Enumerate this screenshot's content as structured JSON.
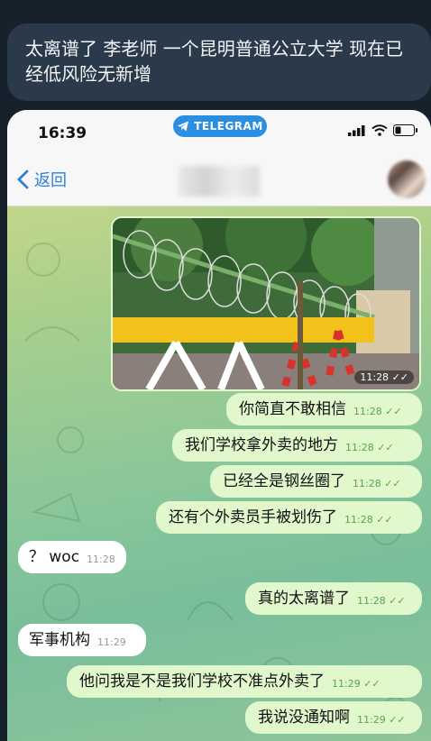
{
  "caption": "太离谱了 李老师 一个昆明普通公立大学 现在已经低风险无新增",
  "status_bar": {
    "time": "16:39",
    "app_badge": "TELEGRAM"
  },
  "nav": {
    "back_label": "返回"
  },
  "photo_message": {
    "time": "11:28"
  },
  "messages": [
    {
      "text": "你简直不敢相信",
      "time": "11:28",
      "direction": "out"
    },
    {
      "text": "我们学校拿外卖的地方",
      "time": "11:28",
      "direction": "out"
    },
    {
      "text": "已经全是钢丝圈了",
      "time": "11:28",
      "direction": "out"
    },
    {
      "text": "还有个外卖员手被划伤了",
      "time": "11:28",
      "direction": "out"
    },
    {
      "text": "？ woc",
      "time": "11:28",
      "direction": "in"
    },
    {
      "text": "真的太离谱了",
      "time": "11:28",
      "direction": "out"
    },
    {
      "text": "军事机构",
      "time": "11:29",
      "direction": "in"
    },
    {
      "text": "他问我是不是我们学校不准点外卖了",
      "time": "11:29",
      "direction": "out"
    },
    {
      "text": "我说没通知啊",
      "time": "11:29",
      "direction": "out"
    }
  ],
  "icons": [
    "telegram-icon",
    "signal-icon",
    "wifi-icon",
    "battery-icon",
    "chevron-left-icon",
    "double-check-icon"
  ]
}
